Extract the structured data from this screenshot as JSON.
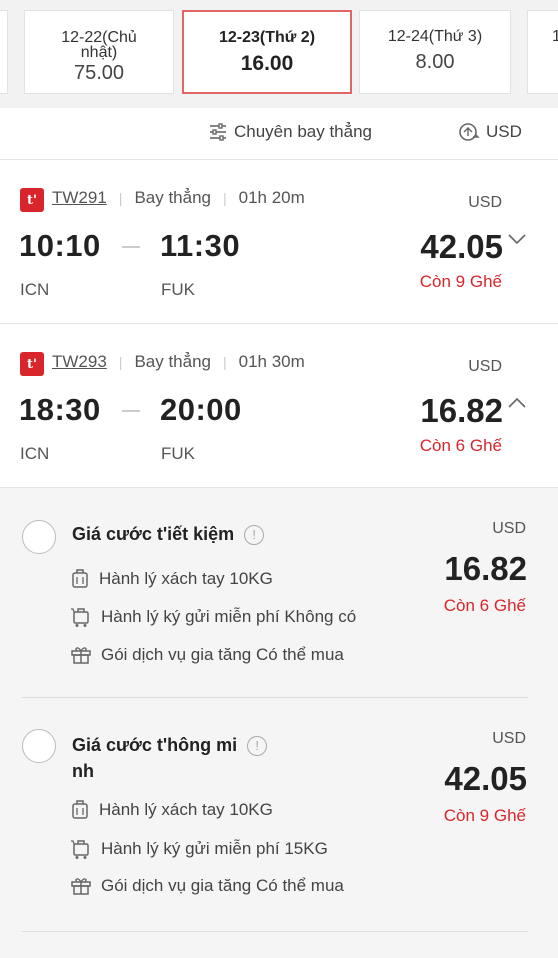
{
  "dates": [
    {
      "label": "",
      "price": ""
    },
    {
      "label": "12-22(Chủ nhật)",
      "price": "75.00"
    },
    {
      "label": "12-23(Thứ 2)",
      "price": "16.00"
    },
    {
      "label": "12-24(Thứ 3)",
      "price": "8.00"
    },
    {
      "label": "1",
      "price": ""
    }
  ],
  "filters": {
    "direct_label": "Chuyên bay thẳng",
    "currency_label": "USD"
  },
  "flights": [
    {
      "flight_no": "TW291",
      "type": "Bay thẳng",
      "duration": "01h 20m",
      "depart_time": "10:10",
      "arrive_time": "11:30",
      "from": "ICN",
      "to": "FUK",
      "currency": "USD",
      "price": "42.05",
      "seats": "Còn 9 Ghế",
      "expanded": false
    },
    {
      "flight_no": "TW293",
      "type": "Bay thẳng",
      "duration": "01h 30m",
      "depart_time": "18:30",
      "arrive_time": "20:00",
      "from": "ICN",
      "to": "FUK",
      "currency": "USD",
      "price": "16.82",
      "seats": "Còn 6 Ghế",
      "expanded": true
    }
  ],
  "fares": [
    {
      "title": "Giá cước t'iết kiệm",
      "currency": "USD",
      "price": "16.82",
      "seats": "Còn 6 Ghế",
      "carry_on": "Hành lý xách tay 10KG",
      "checked": "Hành lý ký gửi miễn phí Không có",
      "addon": "Gói dịch vụ gia tăng Có thể mua"
    },
    {
      "title": "Giá cước t'hông mi",
      "title_line2": "nh",
      "currency": "USD",
      "price": "42.05",
      "seats": "Còn 9 Ghế",
      "carry_on": "Hành lý xách tay 10KG",
      "checked": "Hành lý ký gửi miễn phí 15KG",
      "addon": "Gói dịch vụ gia tăng Có thể mua"
    }
  ],
  "colors": {
    "accent_red": "#d9262c",
    "selected_border": "#e06666"
  }
}
